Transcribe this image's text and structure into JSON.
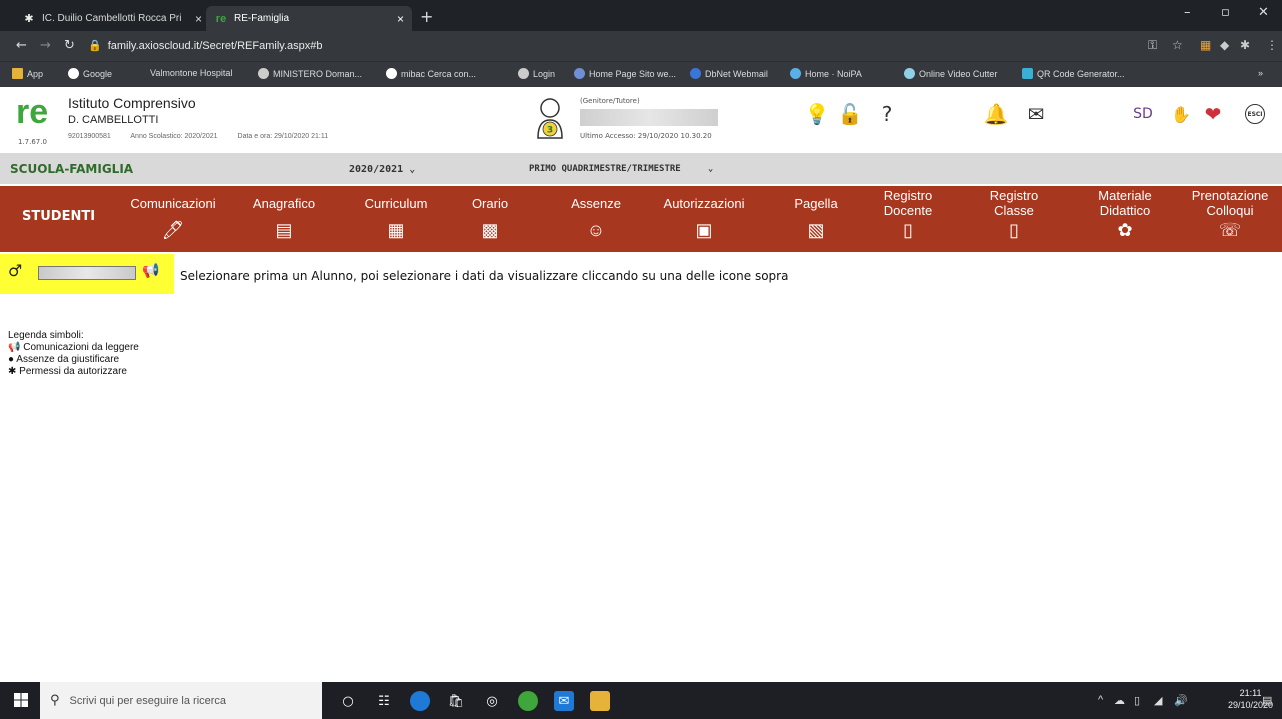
{
  "browser": {
    "tabs": [
      {
        "label": "IC. Duilio Cambellotti Rocca Pri",
        "active": false
      },
      {
        "label": "RE-Famiglia",
        "active": true
      }
    ],
    "tab_close": "×",
    "new_tab": "+",
    "url": "family.axioscloud.it/Secret/REFamily.aspx#b",
    "bookmarks": [
      "App",
      "Google",
      "Valmontone Hospital",
      "MINISTERO Doman...",
      "mibac  Cerca con...",
      "Login",
      "Home Page Sito we...",
      "DbNet Webmail",
      "Home · NoiPA",
      "Online Video Cutter",
      "QR Code Generator..."
    ],
    "bookmarks_more": "»",
    "colors": {
      "accent": "#a7371e",
      "highlight": "#ffff33",
      "brand_green": "#3ea63a",
      "tab_bg": "#1f2327",
      "toolbar_bg": "#35393e"
    }
  },
  "header": {
    "logo": "re",
    "version": "1.7.67.0",
    "school_title": "Istituto Comprensivo",
    "school_subtitle": "D. CAMBELLOTTI",
    "school_code": "92013900581",
    "school_year": "Anno Scolastico: 2020/2021",
    "date_label": "Data e ora: 29/10/2020 21:11",
    "user_role": "(Genitore/Tutore)",
    "user_badge": "3",
    "last_access": "Ultimo Accesso: 29/10/2020 10.30.20",
    "esci": "ESCI",
    "sd": "SD"
  },
  "sfbar": {
    "title": "SCUOLA-FAMIGLIA",
    "year": "2020/2021",
    "period": "PRIMO QUADRIMESTRE/TRIMESTRE",
    "chevron": "⌄"
  },
  "nav": {
    "students_label": "STUDENTI",
    "items": [
      {
        "label": "Comunicazioni",
        "icon": "🖊"
      },
      {
        "label": "Anagrafico",
        "icon": "▤"
      },
      {
        "label": "Curriculum",
        "icon": "▦"
      },
      {
        "label": "Orario",
        "icon": "▩"
      },
      {
        "label": "Assenze",
        "icon": "☺"
      },
      {
        "label": "Autorizzazioni",
        "icon": "▣"
      },
      {
        "label": "Pagella",
        "icon": "▧"
      },
      {
        "label": "Registro\nDocente",
        "icon": "▯"
      },
      {
        "label": "Registro\nClasse",
        "icon": "▯"
      },
      {
        "label": "Materiale\nDidattico",
        "icon": "✿"
      },
      {
        "label": "Prenotazione\nColloqui",
        "icon": "☏"
      }
    ]
  },
  "selection": {
    "gender_symbol": "♂",
    "megaphone": "📢",
    "message": "Selezionare prima un Alunno, poi selezionare i dati da visualizzare cliccando su una delle icone sopra"
  },
  "legend": {
    "title": "Legenda simboli:",
    "items": [
      {
        "symbol": "📢",
        "label": "Comunicazioni da leggere"
      },
      {
        "symbol": "●",
        "label": "Assenze da giustificare"
      },
      {
        "symbol": "✱",
        "label": "Permessi da autorizzare"
      }
    ]
  },
  "taskbar": {
    "search_placeholder": "Scrivi qui per eseguire la ricerca",
    "time": "21:11",
    "date": "29/10/2020"
  }
}
